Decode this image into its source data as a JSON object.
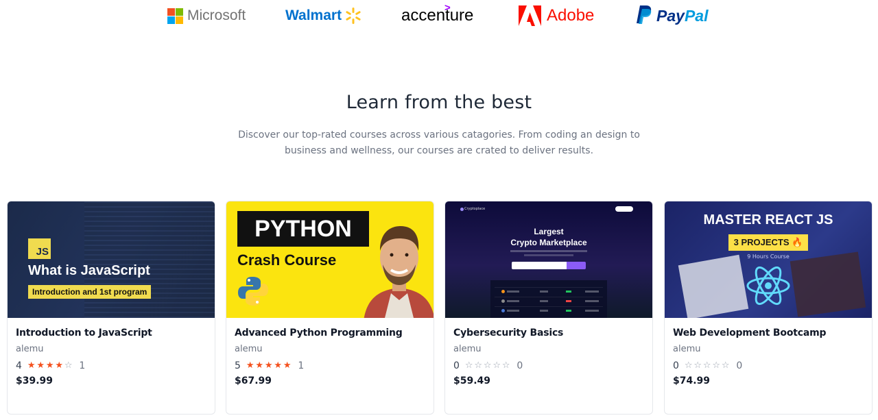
{
  "partners": {
    "microsoft": "Microsoft",
    "walmart": "Walmart",
    "accenture": "accenture",
    "adobe": "Adobe",
    "paypal_pay": "Pay",
    "paypal_pal": "Pal"
  },
  "section": {
    "title": "Learn from the best",
    "description": "Discover our top-rated courses across various catagories. From coding an design to business and wellness, our courses are crated to deliver results."
  },
  "courses": [
    {
      "title": "Introduction to JavaScript",
      "author": "alemu",
      "rating": "4",
      "stars_filled": 4,
      "rating_count": "1",
      "price": "$39.99",
      "thumb": {
        "badge": "JS",
        "headline": "What is JavaScript",
        "sub": "Introduction and 1st program"
      }
    },
    {
      "title": "Advanced Python Programming",
      "author": "alemu",
      "rating": "5",
      "stars_filled": 5,
      "rating_count": "1",
      "price": "$67.99",
      "thumb": {
        "headline": "PYTHON",
        "sub": "Crash Course"
      }
    },
    {
      "title": "Cybersecurity Basics",
      "author": "alemu",
      "rating": "0",
      "stars_filled": 0,
      "rating_count": "0",
      "price": "$59.49",
      "thumb": {
        "brand": "Cryptoplace",
        "headline": "Largest",
        "headline2": "Crypto Marketplace"
      }
    },
    {
      "title": "Web Development Bootcamp",
      "author": "alemu",
      "rating": "0",
      "stars_filled": 0,
      "rating_count": "0",
      "price": "$74.99",
      "thumb": {
        "headline": "MASTER REACT JS",
        "tag": "3 PROJECTS 🔥",
        "hours": "9 Hours Course"
      }
    }
  ],
  "colors": {
    "star_filled": "#f4511e",
    "star_empty": "#9ca3af",
    "heading": "#1f2937",
    "muted": "#6b7280"
  }
}
